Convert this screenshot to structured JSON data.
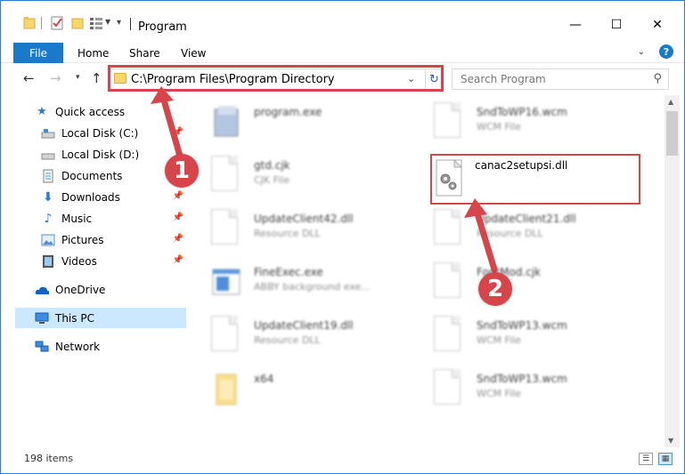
{
  "window": {
    "title": "Program",
    "minimize": "—",
    "maximize": "☐",
    "close": "✕"
  },
  "ribbon": {
    "file": "File",
    "tabs": [
      "Home",
      "Share",
      "View"
    ],
    "help": "?"
  },
  "nav": {
    "address": "C:\\Program Files\\Program Directory",
    "search_placeholder": "Search Program"
  },
  "sidebar": {
    "items": [
      {
        "label": "Quick access",
        "icon": "star-icon",
        "pinned": false
      },
      {
        "label": "Local Disk (C:)",
        "icon": "drive-icon",
        "pinned": true
      },
      {
        "label": "Local Disk (D:)",
        "icon": "drive-icon",
        "pinned": false
      },
      {
        "label": "Documents",
        "icon": "documents-icon",
        "pinned": true
      },
      {
        "label": "Downloads",
        "icon": "downloads-icon",
        "pinned": true
      },
      {
        "label": "Music",
        "icon": "music-icon",
        "pinned": true
      },
      {
        "label": "Pictures",
        "icon": "pictures-icon",
        "pinned": true
      },
      {
        "label": "Videos",
        "icon": "videos-icon",
        "pinned": true
      },
      {
        "label": "OneDrive",
        "icon": "onedrive-icon",
        "pinned": false
      },
      {
        "label": "This PC",
        "icon": "this-pc-icon",
        "pinned": false,
        "selected": true
      },
      {
        "label": "Network",
        "icon": "network-icon",
        "pinned": false
      }
    ]
  },
  "files": {
    "left": [
      {
        "name": "program.exe",
        "type": "",
        "icon": "exe-icon"
      },
      {
        "name": "gtd.cjk",
        "type": "CJK File",
        "icon": "document-icon"
      },
      {
        "name": "UpdateClient42.dll",
        "type": "Resource DLL",
        "icon": "dll-icon"
      },
      {
        "name": "FineExec.exe",
        "type": "ABBY background exe...",
        "icon": "app-window-icon"
      },
      {
        "name": "UpdateClient19.dll",
        "type": "Resource DLL",
        "icon": "dll-icon"
      },
      {
        "name": "x64",
        "type": "",
        "icon": "folder-icon"
      }
    ],
    "right": [
      {
        "name": "SndToWP16.wcm",
        "type": "WCM File",
        "icon": "document-icon"
      },
      {
        "name": "canac2setupsi.dll",
        "type": "",
        "icon": "dll-gear-icon",
        "highlighted": true
      },
      {
        "name": "UpdateClient21.dll",
        "type": "Resource DLL",
        "icon": "dll-icon"
      },
      {
        "name": "FontMod.cjk",
        "type": "",
        "icon": "document-icon"
      },
      {
        "name": "SndToWP13.wcm",
        "type": "WCM File",
        "icon": "document-icon"
      },
      {
        "name": "SndToWP13.wcm",
        "type": "WCM File",
        "icon": "document-icon"
      }
    ]
  },
  "status": {
    "items": "198 items"
  },
  "callouts": [
    "1",
    "2"
  ],
  "colors": {
    "accent": "#1979ca",
    "highlight": "#d7444a",
    "selection": "#cce8ff"
  }
}
